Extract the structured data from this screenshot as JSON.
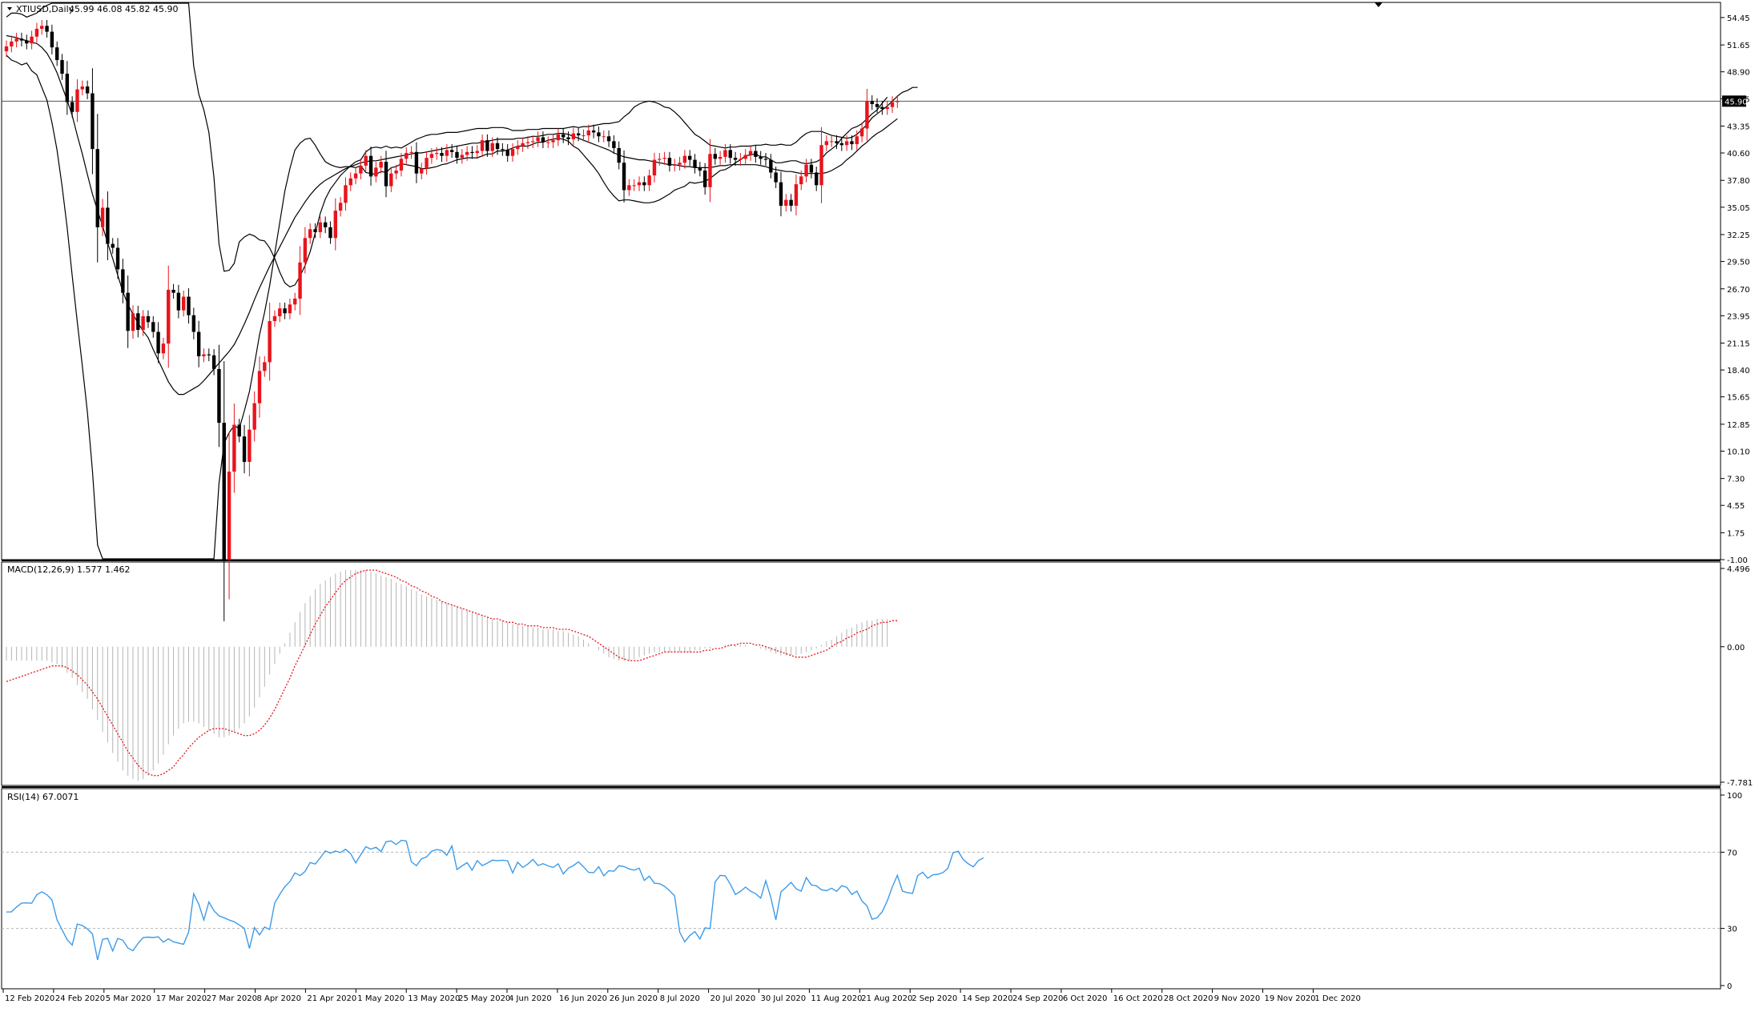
{
  "header": {
    "symbol": "XTIUSD,Daily",
    "ohlc": "45.99 46.08 45.82 45.90"
  },
  "main_price_axis": [
    "54.45",
    "51.65",
    "48.90",
    "46.15",
    "43.35",
    "40.60",
    "37.80",
    "35.05",
    "32.25",
    "29.50",
    "26.70",
    "23.95",
    "21.15",
    "18.40",
    "15.65",
    "12.85",
    "10.10",
    "7.30",
    "4.55",
    "1.75",
    "-1.00"
  ],
  "current_price_tag": "45.90",
  "macd": {
    "label": "MACD(12,26,9) 1.577 1.462",
    "axis": [
      "4.496",
      "0.00",
      "-7.781"
    ]
  },
  "rsi": {
    "label": "RSI(14) 67.0071",
    "axis": [
      "100",
      "70",
      "30",
      "0"
    ]
  },
  "date_axis": [
    "12 Feb 2020",
    "24 Feb 2020",
    "5 Mar 2020",
    "17 Mar 2020",
    "27 Mar 2020",
    "8 Apr 2020",
    "21 Apr 2020",
    "1 May 2020",
    "13 May 2020",
    "25 May 2020",
    "4 Jun 2020",
    "16 Jun 2020",
    "26 Jun 2020",
    "8 Jul 2020",
    "20 Jul 2020",
    "30 Jul 2020",
    "11 Aug 2020",
    "21 Aug 2020",
    "2 Sep 2020",
    "14 Sep 2020",
    "24 Sep 2020",
    "6 Oct 2020",
    "16 Oct 2020",
    "28 Oct 2020",
    "9 Nov 2020",
    "19 Nov 2020",
    "1 Dec 2020"
  ],
  "colors": {
    "bull": "#e8141c",
    "bear": "#000000",
    "signal": "#e8141c",
    "macd_hist": "#b4b4b4",
    "rsi_line": "#3d9be9",
    "grid_level": "#b4b4b4"
  },
  "chart_data": [
    {
      "type": "candlestick",
      "title": "XTIUSD,Daily",
      "ylim": [
        -1.0,
        56.0
      ],
      "closes": [
        51.5,
        52.0,
        52.3,
        52.1,
        51.8,
        52.5,
        53.3,
        53.6,
        53.0,
        51.4,
        50.1,
        48.7,
        45.8,
        44.8,
        47.1,
        47.4,
        46.7,
        41.0,
        33.0,
        35.0,
        31.3,
        30.9,
        28.7,
        26.3,
        22.4,
        24.2,
        22.5,
        23.9,
        23.3,
        22.3,
        20.1,
        21.1,
        26.6,
        26.3,
        24.5,
        25.9,
        24.0,
        22.3,
        19.8,
        20.0,
        19.9,
        18.5,
        13.0,
        -1.0,
        8.0,
        12.8,
        11.6,
        9.0,
        12.3,
        15.0,
        18.3,
        19.2,
        23.4,
        23.9,
        24.7,
        24.2,
        25.1,
        25.7,
        29.4,
        31.9,
        32.8,
        32.5,
        33.5,
        33.0,
        31.9,
        34.7,
        35.5,
        37.3,
        38.0,
        38.5,
        39.3,
        40.3,
        38.2,
        39.1,
        39.7,
        37.2,
        38.5,
        38.8,
        40.0,
        40.6,
        40.7,
        38.5,
        39.0,
        40.1,
        40.5,
        40.6,
        40.3,
        40.9,
        40.7,
        40.1,
        40.4,
        40.7,
        40.6,
        40.8,
        41.9,
        40.8,
        41.6,
        41.0,
        40.9,
        40.3,
        41.0,
        41.3,
        41.6,
        41.7,
        41.8,
        42.2,
        41.7,
        41.7,
        41.9,
        42.5,
        42.2,
        42.0,
        42.6,
        42.4,
        42.4,
        42.9,
        42.7,
        42.3,
        42.3,
        41.8,
        41.1,
        39.6,
        36.8,
        37.3,
        37.3,
        37.6,
        37.3,
        38.3,
        39.9,
        40.0,
        40.1,
        39.3,
        39.4,
        39.6,
        40.3,
        39.9,
        39.1,
        38.8,
        37.1,
        40.5,
        40.0,
        40.2,
        40.9,
        40.1,
        39.9,
        40.0,
        40.4,
        40.8,
        40.2,
        40.0,
        39.9,
        38.6,
        37.6,
        35.2,
        35.8,
        35.2,
        37.4,
        38.2,
        39.4,
        38.6,
        37.3,
        41.4,
        41.8,
        41.8,
        41.6,
        41.4,
        41.8,
        41.5,
        42.3,
        43.1,
        45.9,
        45.6,
        45.3,
        45.1,
        45.3,
        45.8,
        45.9
      ],
      "bollinger_upper": [
        54.5,
        54.9,
        54.9,
        54.8,
        54.5,
        54.7,
        54.9,
        55.4,
        55.7,
        56.1,
        56.7,
        57.5,
        59.0,
        60.9,
        61.6,
        62.2,
        62.7,
        64.7,
        69.0,
        70.8,
        72.8,
        74.3,
        76.3,
        78.0,
        78.6,
        79.2,
        79.4,
        78.9,
        78.5,
        78.2,
        76.9,
        75.7,
        73.6,
        71.5,
        68.9,
        64.8,
        56.8,
        49.5,
        46.6,
        45.0,
        42.7,
        38.1,
        31.3,
        28.5,
        28.6,
        29.3,
        31.5,
        32.0,
        32.3,
        32.1,
        31.7,
        31.6,
        30.9,
        29.8,
        28.4,
        27.3,
        26.9,
        27.1,
        28.0,
        29.1,
        30.5,
        32.4,
        34.4,
        35.9,
        36.9,
        37.6,
        38.3,
        38.8,
        39.3,
        39.7,
        39.9,
        40.7,
        41.1,
        41.2,
        41.1,
        41.3,
        41.1,
        41.2,
        41.1,
        41.4,
        41.7,
        42.0,
        42.2,
        42.4,
        42.5,
        42.5,
        42.6,
        42.7,
        42.7,
        42.7,
        42.8,
        42.9,
        43.0,
        43.1,
        43.1,
        43.1,
        43.2,
        43.2,
        43.2,
        43.1,
        42.9,
        42.9,
        42.9,
        43.0,
        43.0,
        43.0,
        43.1,
        43.1,
        43.1,
        43.1,
        43.1,
        43.2,
        43.3,
        43.2,
        43.3,
        43.3,
        43.4,
        43.5,
        43.6,
        43.6,
        43.7,
        43.8,
        44.3,
        44.7,
        45.3,
        45.6,
        45.8,
        45.9,
        45.8,
        45.6,
        45.3,
        45.2,
        44.8,
        44.3,
        43.7,
        43.1,
        42.5,
        42.2,
        41.8,
        41.4,
        41.3,
        41.2,
        41.1,
        41.2,
        41.2,
        41.3,
        41.3,
        41.3,
        41.4,
        41.4,
        41.5,
        41.4,
        41.4,
        41.5,
        41.4,
        41.4,
        41.7,
        42.2,
        42.6,
        42.8,
        42.8,
        42.8,
        42.6,
        42.4,
        42.3,
        42.2,
        42.1,
        42.2,
        42.5,
        43.0,
        43.5,
        44.2,
        44.6,
        45.0,
        45.4,
        45.9,
        46.4,
        46.8,
        47.0,
        47.3,
        47.3
      ],
      "bollinger_mid": [
        52.6,
        52.5,
        52.4,
        52.2,
        52.1,
        51.9,
        51.8,
        51.4,
        50.8,
        49.9,
        48.8,
        47.4,
        46.0,
        44.4,
        42.4,
        40.5,
        38.4,
        36.4,
        34.7,
        33.1,
        31.4,
        29.8,
        28.1,
        26.4,
        25.1,
        24.1,
        23.2,
        22.4,
        21.7,
        20.5,
        19.4,
        18.3,
        17.2,
        16.4,
        15.9,
        15.9,
        16.2,
        16.5,
        16.8,
        17.3,
        17.9,
        18.5,
        19.1,
        19.7,
        20.3,
        21.0,
        22.0,
        23.1,
        24.3,
        25.6,
        26.8,
        27.9,
        29.0,
        30.0,
        31.0,
        32.0,
        33.0,
        34.0,
        34.8,
        35.6,
        36.3,
        36.9,
        37.4,
        37.8,
        38.1,
        38.4,
        38.7,
        39.0,
        39.2,
        39.4,
        39.6,
        39.7,
        39.8,
        39.8,
        39.9,
        40.0,
        40.1,
        40.2,
        40.3,
        40.4,
        40.5,
        40.6,
        40.6,
        40.7,
        40.8,
        40.9,
        41.0,
        41.1,
        41.2,
        41.3,
        41.4,
        41.5,
        41.6,
        41.6,
        41.7,
        41.8,
        41.9,
        42.0,
        42.0,
        42.0,
        42.0,
        42.1,
        42.1,
        42.2,
        42.3,
        42.3,
        42.4,
        42.5,
        42.5,
        42.6,
        42.6,
        42.5,
        42.3,
        42.1,
        41.9,
        41.7,
        41.5,
        41.3,
        41.1,
        40.9,
        40.6,
        40.4,
        40.2,
        40.1,
        40.0,
        39.9,
        39.9,
        39.8,
        39.7,
        39.6,
        39.5,
        39.4,
        39.4,
        39.3,
        39.2,
        39.2,
        39.1,
        39.1,
        39.1,
        39.1,
        39.2,
        39.3,
        39.3,
        39.4,
        39.4,
        39.4,
        39.4,
        39.4,
        39.4,
        39.3,
        39.2,
        39.0,
        38.9,
        38.8,
        38.7,
        38.7,
        38.6,
        38.5,
        38.5,
        38.5,
        38.5,
        38.5,
        38.6,
        38.8,
        39.1,
        39.4,
        39.9,
        40.3,
        40.8,
        41.3,
        41.7,
        42.2,
        42.6,
        42.9,
        43.3,
        43.7,
        44.1
      ],
      "bollinger_lower": [
        50.6,
        50.1,
        49.9,
        49.6,
        49.8,
        49.0,
        48.6,
        47.3,
        46.0,
        43.7,
        40.9,
        37.2,
        33.0,
        28.0,
        23.3,
        18.8,
        14.1,
        8.1,
        0.5,
        -4.5,
        -9.9,
        -14.7,
        -20.1,
        -25.1,
        -28.4,
        -30.9,
        -33.0,
        -34.1,
        -35.1,
        -37.3,
        -38.2,
        -39.1,
        -39.1,
        -38.7,
        -37.2,
        -33.0,
        -24.5,
        -16.4,
        -13.0,
        -10.4,
        -6.9,
        -1.1,
        6.8,
        10.9,
        12.0,
        12.7,
        12.4,
        14.2,
        16.2,
        19.0,
        22.0,
        24.3,
        27.0,
        30.3,
        33.5,
        36.7,
        39.0,
        40.9,
        41.6,
        42.0,
        42.1,
        41.4,
        40.5,
        39.7,
        39.4,
        39.2,
        39.1,
        39.2,
        39.2,
        39.1,
        39.3,
        38.6,
        38.5,
        38.4,
        38.7,
        38.6,
        39.1,
        39.2,
        39.5,
        39.4,
        39.3,
        39.2,
        39.0,
        39.0,
        39.1,
        39.2,
        39.4,
        39.5,
        39.7,
        39.9,
        40.0,
        40.1,
        40.1,
        40.1,
        40.3,
        40.5,
        40.5,
        40.8,
        40.8,
        40.9,
        41.1,
        41.3,
        41.3,
        41.3,
        41.5,
        41.7,
        41.7,
        41.9,
        42.0,
        42.1,
        42.0,
        41.8,
        41.3,
        41.0,
        40.4,
        39.8,
        39.2,
        38.5,
        37.6,
        36.8,
        36.2,
        35.7,
        35.8,
        35.8,
        35.7,
        35.6,
        35.5,
        35.5,
        35.6,
        35.8,
        36.1,
        36.4,
        36.8,
        37.0,
        37.2,
        37.6,
        37.5,
        37.6,
        37.7,
        38.0,
        38.4,
        38.8,
        38.9,
        39.2,
        39.6,
        39.9,
        40.3,
        40.4,
        40.5,
        40.2,
        40.2,
        39.9,
        39.6,
        39.6,
        39.7,
        39.8,
        39.8,
        39.6,
        39.5,
        39.6,
        39.7,
        40.0,
        40.6,
        41.0,
        41.4,
        42.1,
        42.6,
        43.1,
        43.3,
        43.6,
        44.1,
        44.6,
        45.0,
        45.7,
        46.3
      ]
    },
    {
      "type": "bar",
      "title": "MACD(12,26,9) 1.577 1.462",
      "ylim": [
        -7.781,
        4.496
      ],
      "macd_values": [
        -0.8,
        -0.8,
        -0.8,
        -0.8,
        -0.8,
        -0.8,
        -0.8,
        -0.8,
        -0.8,
        -0.9,
        -1.0,
        -1.2,
        -1.5,
        -1.8,
        -2.2,
        -2.6,
        -3.0,
        -3.6,
        -4.2,
        -4.9,
        -5.5,
        -6.1,
        -6.6,
        -7.1,
        -7.4,
        -7.6,
        -7.7,
        -7.6,
        -7.4,
        -7.1,
        -6.7,
        -6.2,
        -5.6,
        -5.1,
        -4.7,
        -4.4,
        -4.3,
        -4.3,
        -4.4,
        -4.6,
        -4.8,
        -5.0,
        -5.2,
        -5.2,
        -5.1,
        -4.9,
        -4.7,
        -4.4,
        -4.0,
        -3.5,
        -2.9,
        -2.3,
        -1.6,
        -1.0,
        -0.4,
        0.2,
        0.8,
        1.4,
        2.0,
        2.5,
        2.9,
        3.3,
        3.6,
        3.8,
        4.0,
        4.2,
        4.3,
        4.4,
        4.4,
        4.4,
        4.4,
        4.4,
        4.3,
        4.2,
        4.1,
        4.0,
        3.9,
        3.7,
        3.6,
        3.5,
        3.3,
        3.2,
        3.0,
        2.9,
        2.8,
        2.7,
        2.6,
        2.5,
        2.4,
        2.3,
        2.2,
        2.1,
        2.0,
        1.9,
        1.8,
        1.7,
        1.6,
        1.5,
        1.5,
        1.4,
        1.3,
        1.3,
        1.2,
        1.2,
        1.1,
        1.1,
        1.0,
        1.0,
        1.0,
        0.9,
        0.9,
        0.8,
        0.7,
        0.6,
        0.4,
        0.2,
        0.0,
        -0.2,
        -0.4,
        -0.6,
        -0.7,
        -0.8,
        -0.8,
        -0.8,
        -0.7,
        -0.6,
        -0.5,
        -0.4,
        -0.3,
        -0.3,
        -0.3,
        -0.3,
        -0.3,
        -0.3,
        -0.3,
        -0.3,
        -0.2,
        -0.2,
        -0.1,
        -0.1,
        0.0,
        0.0,
        0.1,
        0.1,
        0.1,
        0.1,
        0.1,
        0.0,
        0.0,
        -0.1,
        -0.2,
        -0.3,
        -0.4,
        -0.5,
        -0.5,
        -0.5,
        -0.5,
        -0.4,
        -0.3,
        -0.2,
        -0.1,
        0.1,
        0.3,
        0.4,
        0.6,
        0.8,
        1.0,
        1.1,
        1.3,
        1.4,
        1.5,
        1.5,
        1.6,
        1.6,
        1.6
      ],
      "signal_values": [
        -2.0,
        -1.9,
        -1.8,
        -1.7,
        -1.6,
        -1.5,
        -1.4,
        -1.3,
        -1.2,
        -1.1,
        -1.1,
        -1.1,
        -1.2,
        -1.4,
        -1.6,
        -1.9,
        -2.2,
        -2.6,
        -3.0,
        -3.5,
        -4.0,
        -4.5,
        -5.0,
        -5.5,
        -6.0,
        -6.4,
        -6.8,
        -7.1,
        -7.3,
        -7.4,
        -7.4,
        -7.3,
        -7.1,
        -6.9,
        -6.5,
        -6.2,
        -5.8,
        -5.5,
        -5.2,
        -5.0,
        -4.8,
        -4.7,
        -4.7,
        -4.7,
        -4.8,
        -4.9,
        -5.0,
        -5.1,
        -5.1,
        -5.0,
        -4.8,
        -4.5,
        -4.1,
        -3.6,
        -3.0,
        -2.4,
        -1.8,
        -1.1,
        -0.5,
        0.1,
        0.7,
        1.3,
        1.8,
        2.3,
        2.7,
        3.1,
        3.5,
        3.8,
        4.0,
        4.2,
        4.3,
        4.4,
        4.4,
        4.4,
        4.3,
        4.2,
        4.1,
        4.0,
        3.8,
        3.7,
        3.5,
        3.4,
        3.2,
        3.1,
        2.9,
        2.8,
        2.6,
        2.5,
        2.4,
        2.3,
        2.2,
        2.1,
        2.0,
        1.9,
        1.8,
        1.7,
        1.6,
        1.6,
        1.5,
        1.4,
        1.4,
        1.3,
        1.3,
        1.2,
        1.2,
        1.2,
        1.1,
        1.1,
        1.1,
        1.0,
        1.0,
        1.0,
        0.9,
        0.8,
        0.7,
        0.6,
        0.4,
        0.2,
        0.0,
        -0.2,
        -0.4,
        -0.6,
        -0.7,
        -0.8,
        -0.8,
        -0.8,
        -0.7,
        -0.6,
        -0.5,
        -0.4,
        -0.3,
        -0.3,
        -0.3,
        -0.3,
        -0.3,
        -0.3,
        -0.3,
        -0.3,
        -0.2,
        -0.2,
        -0.1,
        -0.1,
        0.0,
        0.1,
        0.1,
        0.2,
        0.2,
        0.2,
        0.1,
        0.1,
        0.0,
        -0.1,
        -0.2,
        -0.3,
        -0.4,
        -0.5,
        -0.6,
        -0.6,
        -0.6,
        -0.5,
        -0.4,
        -0.3,
        -0.2,
        0.0,
        0.2,
        0.3,
        0.5,
        0.6,
        0.8,
        0.9,
        1.0,
        1.2,
        1.3,
        1.4,
        1.4,
        1.5,
        1.5
      ]
    },
    {
      "type": "line",
      "title": "RSI(14) 67.0071",
      "ylim": [
        0,
        100
      ],
      "levels": [
        70,
        30
      ],
      "values": [
        38.6,
        38.7,
        41.2,
        43.3,
        43.4,
        43.2,
        47.7,
        49.2,
        47.7,
        44.9,
        34.5,
        29.3,
        24.1,
        21.2,
        32.3,
        31.5,
        29.7,
        27.1,
        13.5,
        24.3,
        24.8,
        18.2,
        24.8,
        23.8,
        19.7,
        18.3,
        22.1,
        25.2,
        25.4,
        25.2,
        25.6,
        22.8,
        24.5,
        23.0,
        22.3,
        21.7,
        28.1,
        48.2,
        42.7,
        34.4,
        43.9,
        39.3,
        36.6,
        35.6,
        34.4,
        33.5,
        31.8,
        30.0,
        19.5,
        30.4,
        26.6,
        30.7,
        29.4,
        43.4,
        47.9,
        51.9,
        54.6,
        59.1,
        57.7,
        59.9,
        64.6,
        63.8,
        67.0,
        70.7,
        69.5,
        70.6,
        69.8,
        71.5,
        69.2,
        64.4,
        68.7,
        72.9,
        71.6,
        72.6,
        70.3,
        75.5,
        75.9,
        74.0,
        76.2,
        75.9,
        64.9,
        62.9,
        66.5,
        67.5,
        70.5,
        71.4,
        70.9,
        68.4,
        73.3,
        60.9,
        62.8,
        64.5,
        60.6,
        65.6,
        63.0,
        64.3,
        65.8,
        65.6,
        65.8,
        65.5,
        59.1,
        64.7,
        62.0,
        63.8,
        66.2,
        63.0,
        64.0,
        62.8,
        62.0,
        63.9,
        58.6,
        61.6,
        63.0,
        64.9,
        62.3,
        59.4,
        59.3,
        62.4,
        57.6,
        60.3,
        60.0,
        62.9,
        62.5,
        61.2,
        60.6,
        61.6,
        55.2,
        57.4,
        53.7,
        53.5,
        52.1,
        49.8,
        47.1,
        28.0,
        23.0,
        26.3,
        28.3,
        24.5,
        30.3,
        29.9,
        54.4,
        57.8,
        57.6,
        53.2,
        47.8,
        49.4,
        51.7,
        49.6,
        48.2,
        45.9,
        55.0,
        46.3,
        34.5,
        49.2,
        51.5,
        54.2,
        50.8,
        49.6,
        56.7,
        52.8,
        52.4,
        50.3,
        49.8,
        51.1,
        49.4,
        52.4,
        51.6,
        47.8,
        49.6,
        44.4,
        41.8,
        34.8,
        35.6,
        38.8,
        44.4,
        51.8,
        57.9,
        49.6,
        48.8,
        48.4,
        57.7,
        59.5,
        56.3,
        58.1,
        58.4,
        59.3,
        61.6,
        69.7,
        70.5,
        66.2,
        63.9,
        62.3,
        65.6,
        67.0
      ]
    }
  ]
}
